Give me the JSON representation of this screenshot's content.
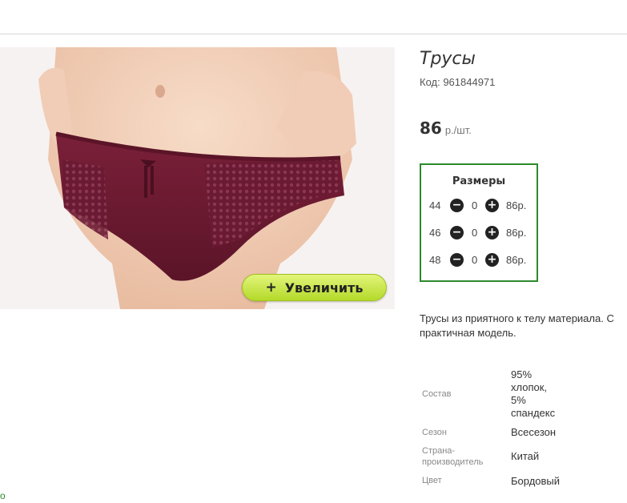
{
  "product": {
    "title": "Трусы",
    "code": "Код: 961844971",
    "price_value": "86",
    "price_unit": "р./шт."
  },
  "image": {
    "zoom_label": "Увеличить",
    "zoom_plus": "+"
  },
  "sizes": {
    "title": "Размеры",
    "rows": [
      {
        "size": "44",
        "qty": "0",
        "price": "86р."
      },
      {
        "size": "46",
        "qty": "0",
        "price": "86р."
      },
      {
        "size": "48",
        "qty": "0",
        "price": "86р."
      }
    ]
  },
  "description": {
    "line1": "Трусы из приятного к телу материала. С",
    "line2": "практичная модель."
  },
  "properties": [
    {
      "label": "Состав",
      "value": [
        "95%",
        "хлопок,",
        "5%",
        "спандекс"
      ]
    },
    {
      "label": "Сезон",
      "value": [
        "Всесезон"
      ]
    },
    {
      "label": [
        "Страна-",
        "производитель"
      ],
      "value": [
        "Китай"
      ]
    },
    {
      "label": "Цвет",
      "value": [
        "Бордовый"
      ]
    }
  ],
  "colors": {
    "frame": "#2c8a2c",
    "button": "#b4d92a",
    "product": "#6e1a33"
  },
  "footer_mark": "о"
}
